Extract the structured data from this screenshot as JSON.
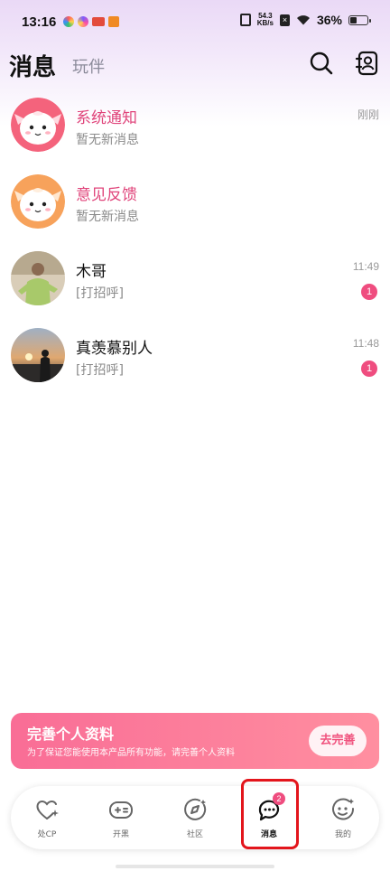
{
  "status_bar": {
    "time": "13:16",
    "net_speed_value": "54.3",
    "net_speed_unit": "KB/s",
    "battery_percent": "36%",
    "battery_level": 0.36
  },
  "header": {
    "active_tab": "消息",
    "inactive_tab": "玩伴"
  },
  "messages": [
    {
      "name": "系统通知",
      "preview": "暂无新消息",
      "time": "刚刚",
      "unread": ""
    },
    {
      "name": "意见反馈",
      "preview": "暂无新消息",
      "time": "",
      "unread": ""
    },
    {
      "name": "木哥",
      "preview": "[打招呼]",
      "time": "11:49",
      "unread": "1"
    },
    {
      "name": "真羡慕别人",
      "preview": "[打招呼]",
      "time": "11:48",
      "unread": "1"
    }
  ],
  "banner": {
    "title": "完善个人资料",
    "subtitle": "为了保证您能使用本产品所有功能，请完善个人资料",
    "button": "去完善"
  },
  "nav": {
    "items": [
      {
        "label": "处CP",
        "icon": "heart-sparkle-icon"
      },
      {
        "label": "开黑",
        "icon": "gamepad-icon"
      },
      {
        "label": "社区",
        "icon": "compass-icon"
      },
      {
        "label": "消息",
        "icon": "chat-bubble-icon",
        "badge": "2"
      },
      {
        "label": "我的",
        "icon": "smile-face-icon"
      }
    ]
  },
  "colors": {
    "accent_pink": "#ef4d7f",
    "highlight_red": "#e3151c"
  }
}
